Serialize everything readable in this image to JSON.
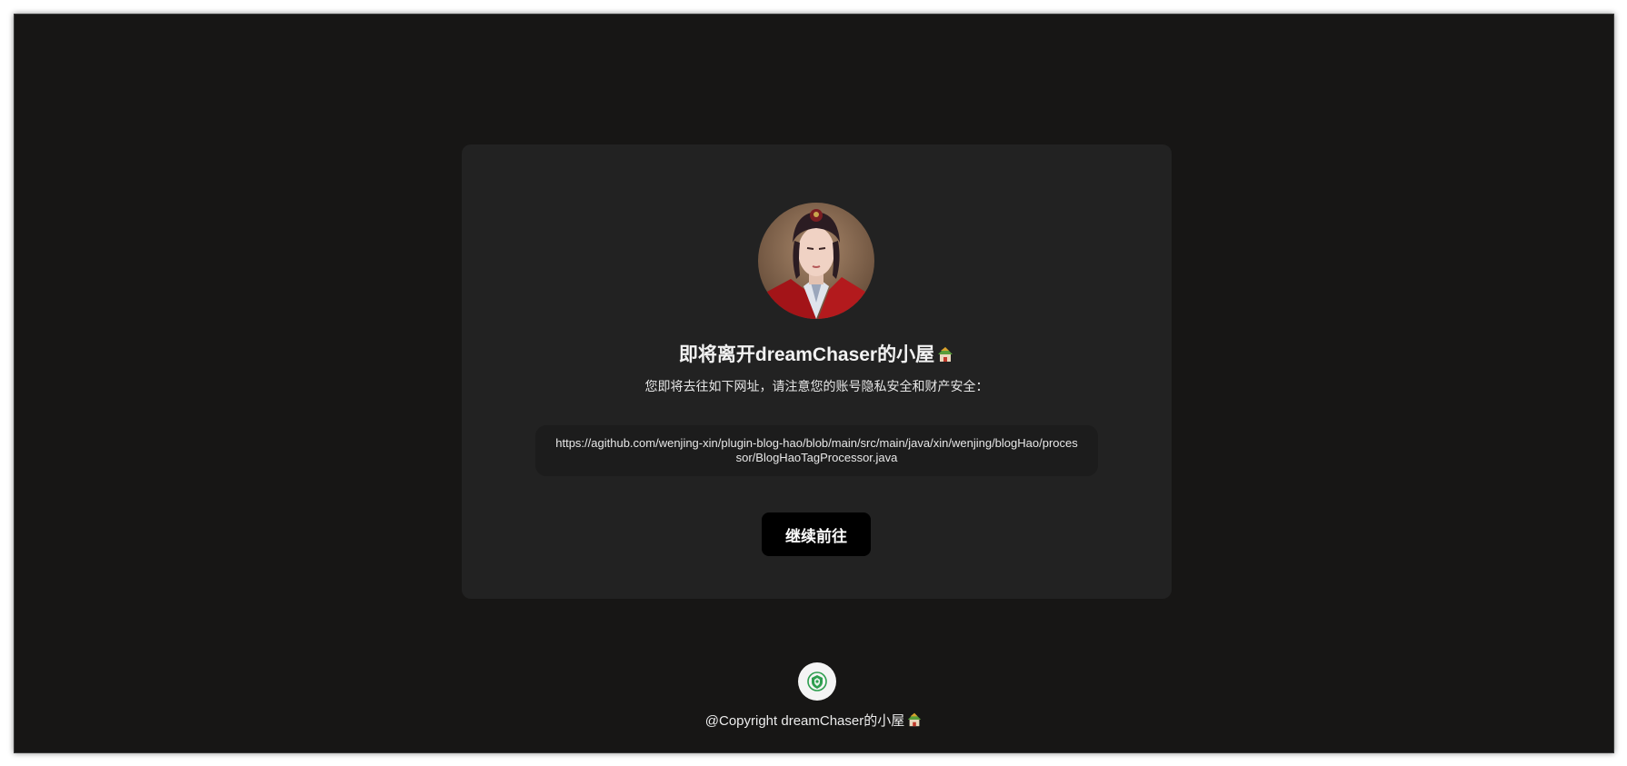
{
  "leave": {
    "title": "即将离开dreamChaser的小屋",
    "subtitle": "您即将去往如下网址，请注意您的账号隐私安全和财产安全：",
    "url": "https://agithub.com/wenjing-xin/plugin-blog-hao/blob/main/src/main/java/xin/wenjing/blogHao/processor/BlogHaoTagProcessor.java",
    "continue_label": "继续前往"
  },
  "footer": {
    "copyright": "@Copyright dreamChaser的小屋"
  },
  "icons": {
    "avatar": "avatar-image",
    "house": "house-icon",
    "footer_logo": "shield-logo-icon"
  },
  "colors": {
    "page_background": "#171615",
    "card_background": "#222222",
    "url_box_background": "#1c1c1c",
    "button_background": "#000000",
    "button_text": "#ffffff"
  }
}
